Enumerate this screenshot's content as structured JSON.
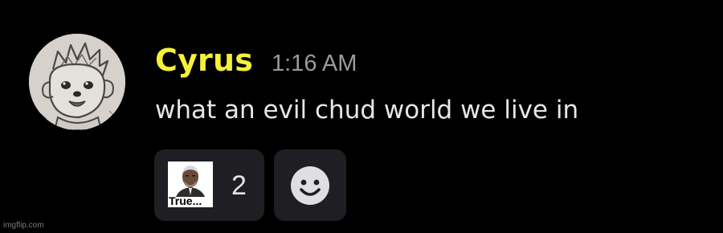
{
  "message": {
    "author": "Cyrus",
    "author_color": "#f5f03a",
    "timestamp": "1:16 AM",
    "content": "what an evil chud world we live in"
  },
  "avatar": {
    "icon": "sketch-character-avatar"
  },
  "reactions": [
    {
      "emoji_icon": "true-meme-image-emoji",
      "emoji_caption": "True...",
      "count": "2"
    }
  ],
  "add_reaction": {
    "icon": "smiley-face-icon"
  },
  "watermark": "imgflip.com",
  "colors": {
    "background": "#000000",
    "pill_background": "#1f1f23",
    "text": "#e6e6ea",
    "muted": "#9a9aa2"
  }
}
